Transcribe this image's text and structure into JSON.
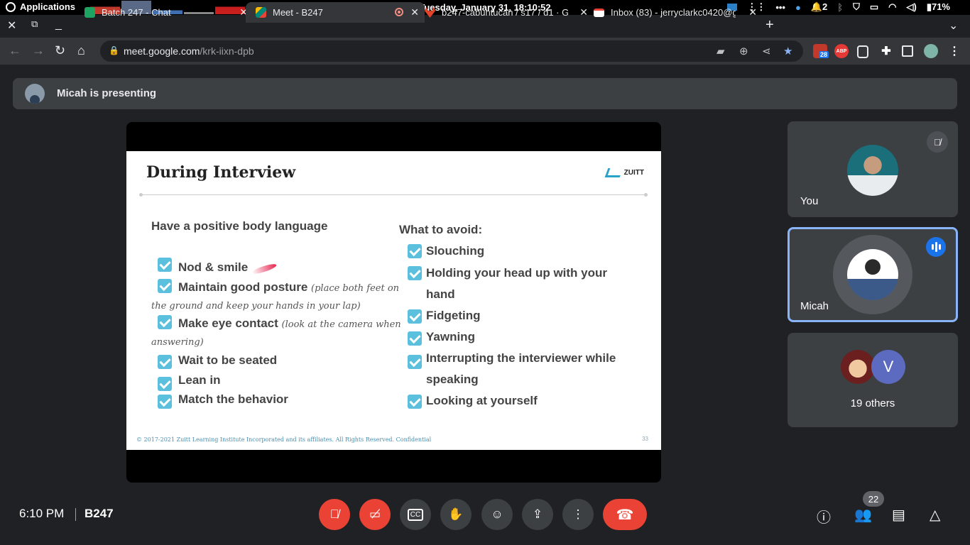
{
  "os_bar": {
    "apps_label": "Applications",
    "clock": "Tuesday, January 31, 18:10:52",
    "notif_count": "2",
    "battery": "71%",
    "colors": {
      "graph1": "#c0392b",
      "graph2": "#5a6a86",
      "graph3": "#3f6fb0",
      "graph4": "#c81e1e"
    }
  },
  "tabs": [
    {
      "title": "Batch 247 - Chat",
      "icon": "google-chat-icon",
      "color": "#1ea362"
    },
    {
      "title": "Meet - B247",
      "icon": "google-meet-icon",
      "color": "#00897b"
    },
    {
      "title": "b247-cabuntucan / s17 / d1 · G",
      "icon": "gitlab-icon",
      "color": "#e24329"
    },
    {
      "title": "Inbox (83) - jerryclarkc0420@g",
      "icon": "gmail-icon",
      "color": "#ea4335"
    }
  ],
  "address_bar": {
    "host": "meet.google.com",
    "path": "/krk-iixn-dpb"
  },
  "extensions": {
    "reminder_badge": "28",
    "abp_label": "ABP"
  },
  "banner": {
    "text": "Micah is presenting"
  },
  "slide": {
    "title": "During Interview",
    "brand": "ZUITT",
    "left_heading": "Have a positive body language",
    "left_items": [
      {
        "label": "Nod & smile",
        "note": ""
      },
      {
        "label": "Maintain good posture",
        "note": "(place both feet on",
        "note2": "the ground and keep your hands in your lap)"
      },
      {
        "label": "Make eye contact",
        "note": "(look at the camera when",
        "note2": "answering)"
      },
      {
        "label": "Wait to be seated",
        "note": ""
      },
      {
        "label": "Lean in",
        "note": ""
      },
      {
        "label": "Match the behavior",
        "note": ""
      }
    ],
    "right_heading": "What to avoid:",
    "right_items": [
      {
        "line1": "Slouching",
        "line2": ""
      },
      {
        "line1": "Holding your head up with your",
        "line2": "hand"
      },
      {
        "line1": "Fidgeting",
        "line2": ""
      },
      {
        "line1": "Yawning",
        "line2": ""
      },
      {
        "line1": "Interrupting the interviewer while",
        "line2": "speaking"
      },
      {
        "line1": "Looking at yourself",
        "line2": ""
      }
    ],
    "footer": "© 2017-2021 Zuitt Learning Institute Incorporated and its affiliates. All Rights Reserved. Confidential",
    "page_number": "33"
  },
  "tiles": {
    "you": {
      "name": "You",
      "muted": true
    },
    "micah": {
      "name": "Micah",
      "speaking": true
    },
    "others": {
      "label": "19 others",
      "avatar_letter": "V",
      "avatar_color": "#5c6bc0"
    }
  },
  "bottom": {
    "time": "6:10 PM",
    "meeting_code": "B247",
    "participants_count": "22"
  }
}
